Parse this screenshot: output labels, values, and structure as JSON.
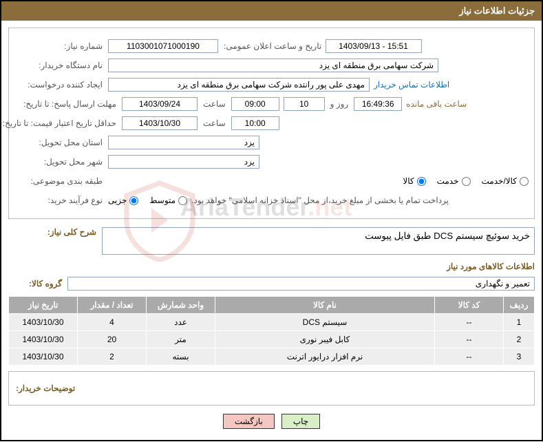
{
  "title": "جزئیات اطلاعات نیاز",
  "labels": {
    "need_no": "شماره نیاز:",
    "announce": "تاریخ و ساعت اعلان عمومی:",
    "buyer_org": "نام دستگاه خریدار:",
    "requester": "ایجاد کننده درخواست:",
    "contact": "اطلاعات تماس خریدار",
    "reply_deadline": "مهلت ارسال پاسخ: تا تاریخ:",
    "hour": "ساعت",
    "day_and": "روز و",
    "remaining": "ساعت باقی مانده",
    "min_validity": "حداقل تاریخ اعتبار قیمت: تا تاریخ:",
    "deliver_prov": "استان محل تحویل:",
    "deliver_city": "شهر محل تحویل:",
    "subject_cat": "طبقه بندی موضوعی:",
    "buy_type": "نوع فرآیند خرید:",
    "cat_goods": "کالا",
    "cat_service": "خدمت",
    "cat_both": "کالا/خدمت",
    "buy_partial": "جزیی",
    "buy_medium": "متوسط",
    "buy_note": "پرداخت تمام یا بخشی از مبلغ خرید،از محل \"اسناد خزانه اسلامی\" خواهد بود.",
    "overall_desc": "شرح کلی نیاز:",
    "items_info": "اطلاعات کالاهای مورد نیاز",
    "goods_group": "گروه کالا:",
    "buyer_remarks": "توضیحات خریدار:",
    "btn_print": "چاپ",
    "btn_back": "بازگشت"
  },
  "values": {
    "need_no": "1103001071000190",
    "announce": "1403/09/13 - 15:51",
    "buyer_org": "شرکت سهامی برق منطقه ای یزد",
    "requester": "مهدی علی پور رانتده شرکت سهامی برق منطقه ای یزد",
    "reply_date": "1403/09/24",
    "reply_hour": "09:00",
    "remain_days": "10",
    "remain_time": "16:49:36",
    "valid_date": "1403/10/30",
    "valid_hour": "10:00",
    "province": "یزد",
    "city": "یزد",
    "overall_desc": "خرید سوئیچ سیستم DCS طبق فایل پیوست",
    "goods_group": "تعمیر و نگهداری"
  },
  "table": {
    "headers": {
      "row": "ردیف",
      "code": "کد کالا",
      "name": "نام کالا",
      "unit": "واحد شمارش",
      "qty": "تعداد / مقدار",
      "need_date": "تاریخ نیاز"
    },
    "rows": [
      {
        "row": "1",
        "code": "--",
        "name": "سیستم DCS",
        "unit": "عدد",
        "qty": "4",
        "need_date": "1403/10/30"
      },
      {
        "row": "2",
        "code": "--",
        "name": "کابل فیبر نوری",
        "unit": "متر",
        "qty": "20",
        "need_date": "1403/10/30"
      },
      {
        "row": "3",
        "code": "--",
        "name": "نرم افزار درایور اترنت",
        "unit": "بسته",
        "qty": "2",
        "need_date": "1403/10/30"
      }
    ]
  }
}
